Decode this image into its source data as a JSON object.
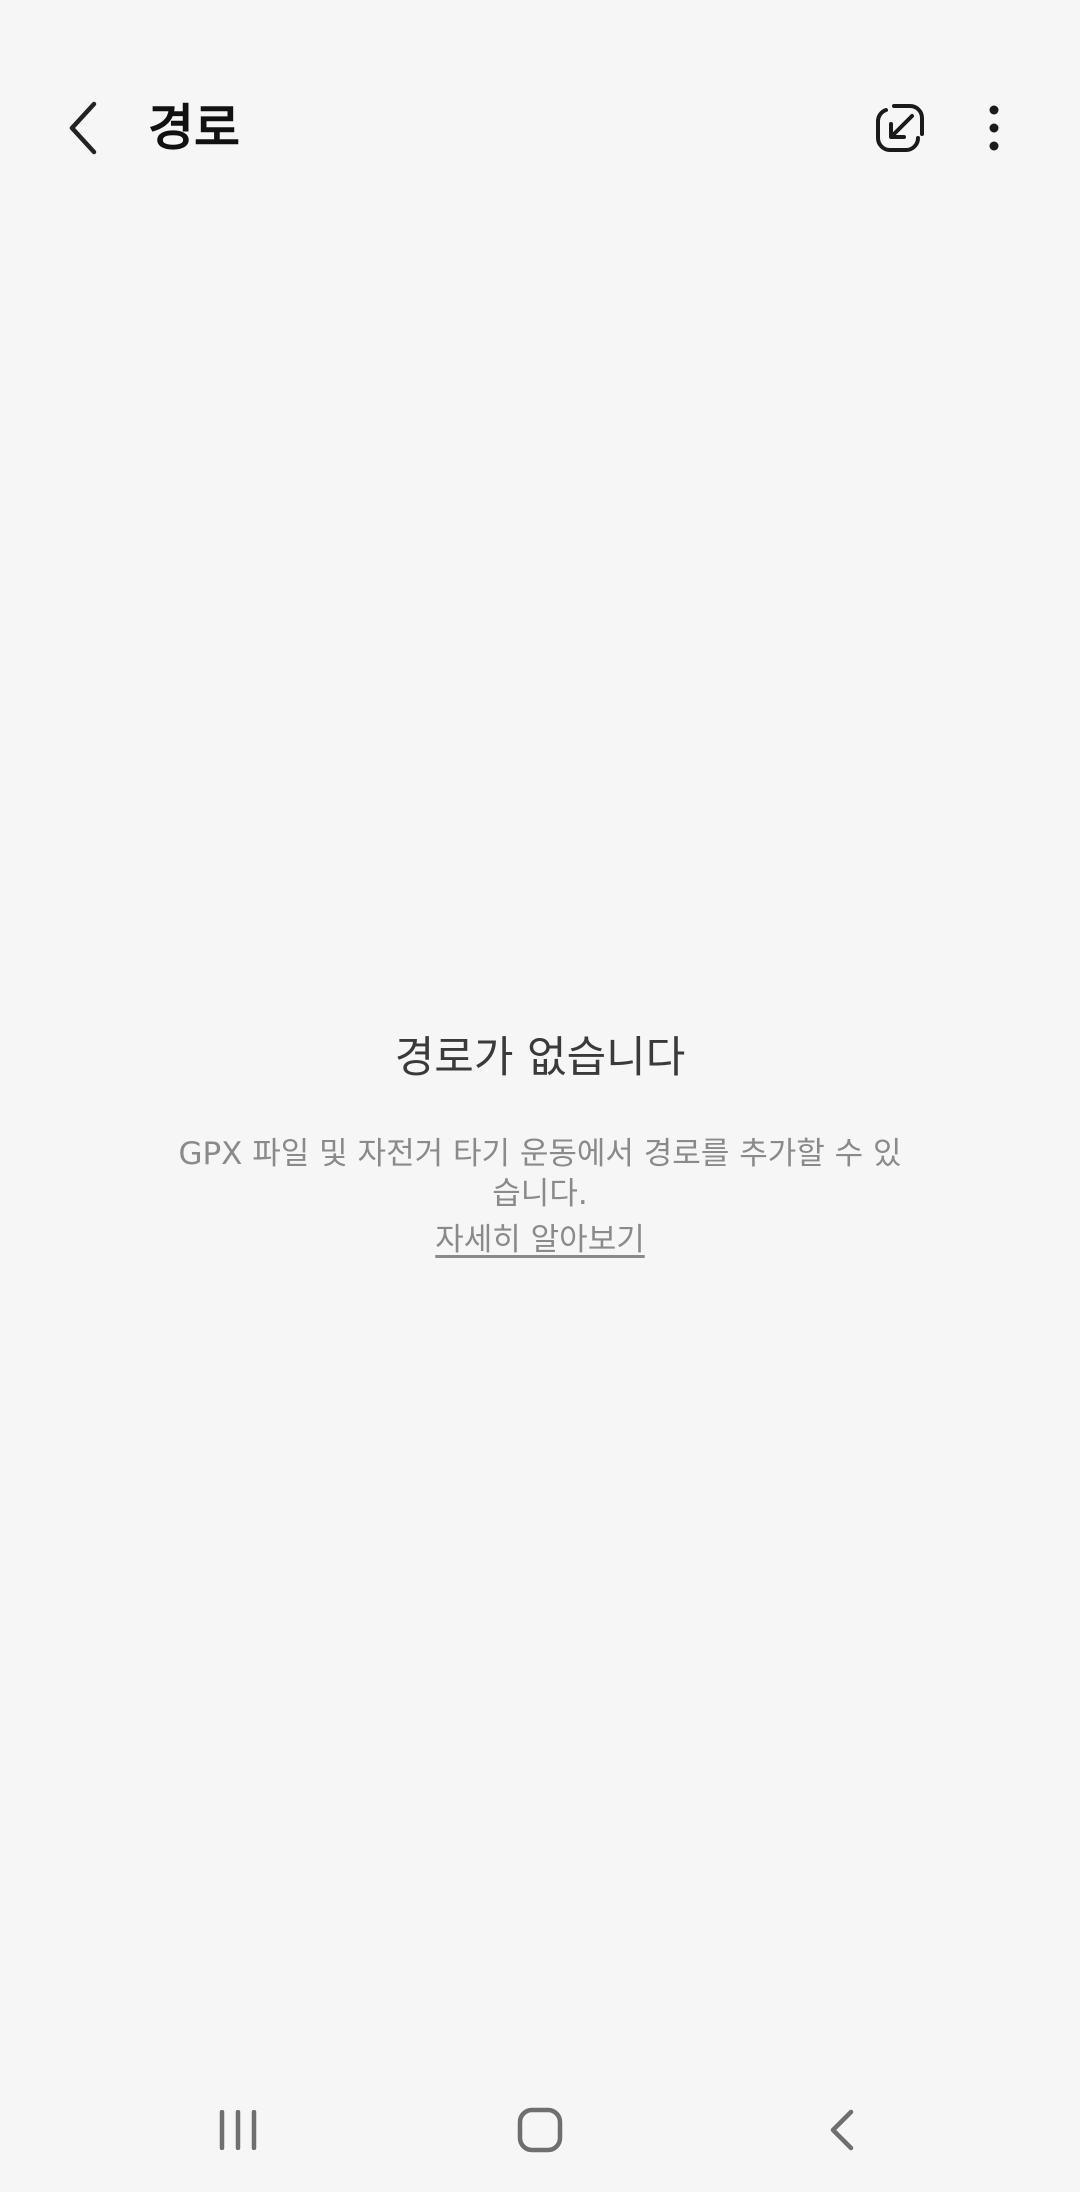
{
  "app_bar": {
    "title": "경로",
    "back_icon": "back-arrow-icon",
    "import_icon": "import-route-icon",
    "more_icon": "more-options-icon"
  },
  "empty_state": {
    "title": "경로가 없습니다",
    "description": "GPX 파일 및 자전거 타기 운동에서 경로를 추가할 수 있습니다.",
    "learn_more": "자세히 알아보기"
  },
  "nav_bar": {
    "recents_icon": "recents-icon",
    "home_icon": "home-icon",
    "back_icon": "back-icon"
  },
  "colors": {
    "background": "#f6f6f6",
    "title": "#111111",
    "empty_title": "#3a3a3a",
    "secondary_text": "#8a8a8a"
  }
}
